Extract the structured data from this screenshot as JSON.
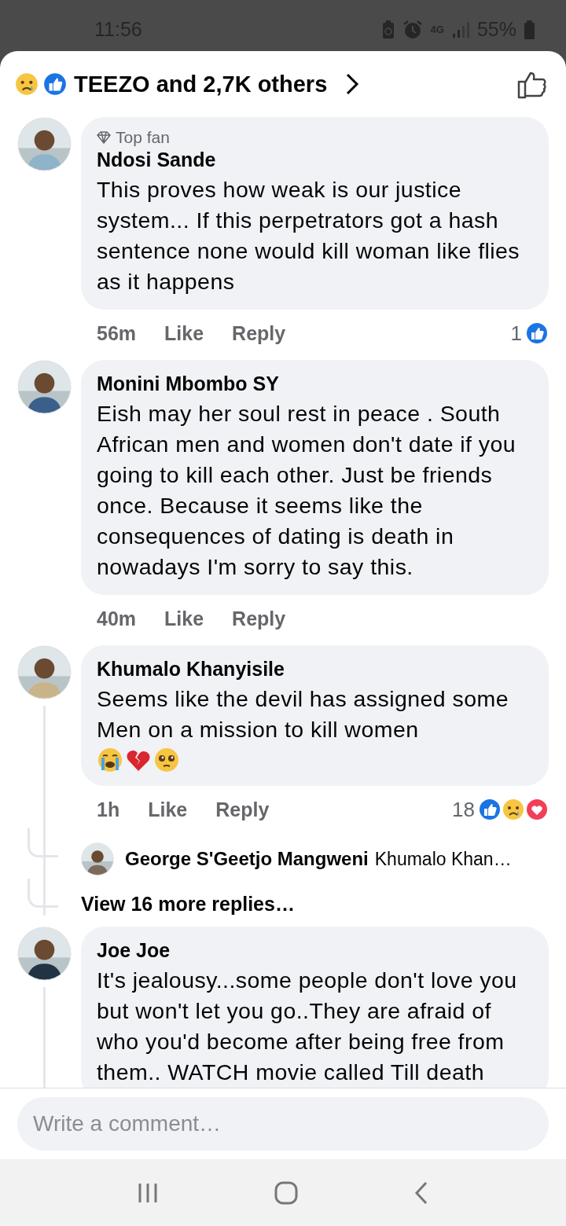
{
  "status_bar": {
    "time": "11:56",
    "network": "4G",
    "battery": "55%"
  },
  "header": {
    "reactions": [
      {
        "kind": "sad"
      },
      {
        "kind": "like"
      }
    ],
    "summary": "TEEZO and 2,7K others"
  },
  "comments": [
    {
      "badge": "Top fan",
      "author": "Ndosi Sande",
      "text": "This proves how weak is our justice system... If this perpetrators got a hash sentence none would kill woman like flies as it happens",
      "time": "56m",
      "like": "Like",
      "reply": "Reply",
      "reaction_count": "1",
      "reactions": [
        {
          "kind": "like"
        }
      ]
    },
    {
      "author": "Monini Mbombo SY",
      "text": "Eish may her soul rest in peace . South African men and women don't date if you going to kill each other. Just be friends once. Because it seems  like the consequences of dating is death in nowadays I'm sorry to say this.",
      "time": "40m",
      "like": "Like",
      "reply": "Reply"
    },
    {
      "author": "Khumalo Khanyisile",
      "text": "Seems like the devil has assigned some Men  on a mission to kill women",
      "emojis": [
        {
          "kind": "crying"
        },
        {
          "kind": "broken-heart"
        },
        {
          "kind": "pleading"
        }
      ],
      "time": "1h",
      "like": "Like",
      "reply": "Reply",
      "reaction_count": "18",
      "reactions": [
        {
          "kind": "like"
        },
        {
          "kind": "sad"
        },
        {
          "kind": "love"
        }
      ],
      "thread": true,
      "replies": [
        {
          "author": "George S'Geetjo Mangweni",
          "text": "Khumalo Khan…"
        }
      ],
      "more_replies": "View 16 more replies…"
    },
    {
      "author": "Joe Joe",
      "text": "It's jealousy...some people don't love you but won't let you go..They are afraid of who you'd become after being free from them.. WATCH movie called Till death",
      "thread": true
    }
  ],
  "composer": {
    "placeholder": "Write a comment…"
  }
}
